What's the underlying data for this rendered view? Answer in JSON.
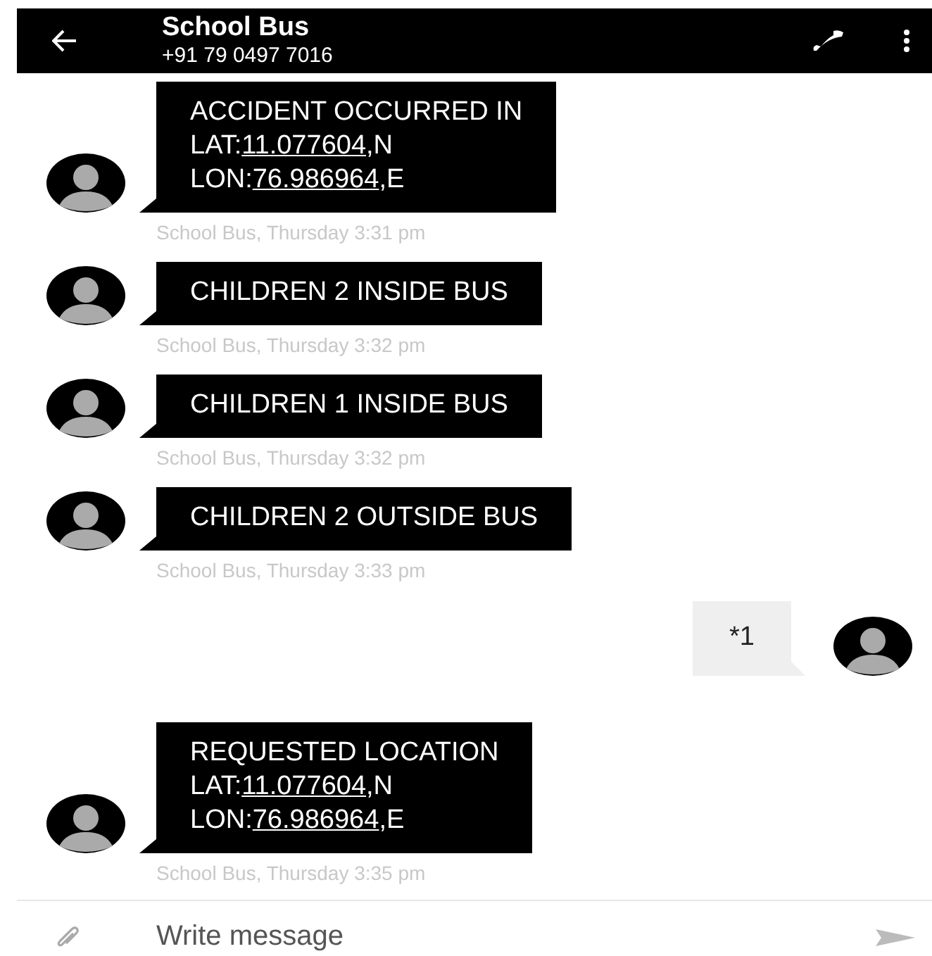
{
  "header": {
    "title": "School Bus",
    "subtitle": "+91 79 0497 7016"
  },
  "messages": [
    {
      "kind": "incoming",
      "lines": [
        [
          {
            "kind": "text",
            "text": "ACCIDENT OCCURRED IN"
          }
        ],
        [
          {
            "kind": "text",
            "text": "LAT:"
          },
          {
            "kind": "link",
            "text": "11.077604"
          },
          {
            "kind": "text",
            "text": ",N"
          }
        ],
        [
          {
            "kind": "text",
            "text": "LON:"
          },
          {
            "kind": "link",
            "text": "76.986964"
          },
          {
            "kind": "text",
            "text": ",E"
          }
        ]
      ],
      "meta": "School Bus, Thursday 3:31 pm"
    },
    {
      "kind": "incoming",
      "lines": [
        [
          {
            "kind": "text",
            "text": "CHILDREN 2 INSIDE BUS"
          }
        ]
      ],
      "meta": "School Bus, Thursday 3:32 pm"
    },
    {
      "kind": "incoming",
      "lines": [
        [
          {
            "kind": "text",
            "text": "CHILDREN 1 INSIDE BUS"
          }
        ]
      ],
      "meta": "School Bus, Thursday 3:32 pm"
    },
    {
      "kind": "incoming",
      "lines": [
        [
          {
            "kind": "text",
            "text": "CHILDREN 2 OUTSIDE BUS"
          }
        ]
      ],
      "meta": "School Bus, Thursday 3:33 pm"
    },
    {
      "kind": "outgoing",
      "lines": [
        [
          {
            "kind": "text",
            "text": "*1"
          }
        ]
      ]
    },
    {
      "kind": "incoming",
      "lines": [
        [
          {
            "kind": "text",
            "text": "REQUESTED LOCATION"
          }
        ],
        [
          {
            "kind": "text",
            "text": "LAT:"
          },
          {
            "kind": "link",
            "text": "11.077604"
          },
          {
            "kind": "text",
            "text": ",N"
          }
        ],
        [
          {
            "kind": "text",
            "text": "LON:"
          },
          {
            "kind": "link",
            "text": "76.986964"
          },
          {
            "kind": "text",
            "text": ",E"
          }
        ]
      ],
      "meta": "School Bus, Thursday 3:35 pm"
    }
  ],
  "composer": {
    "placeholder": "Write message"
  }
}
